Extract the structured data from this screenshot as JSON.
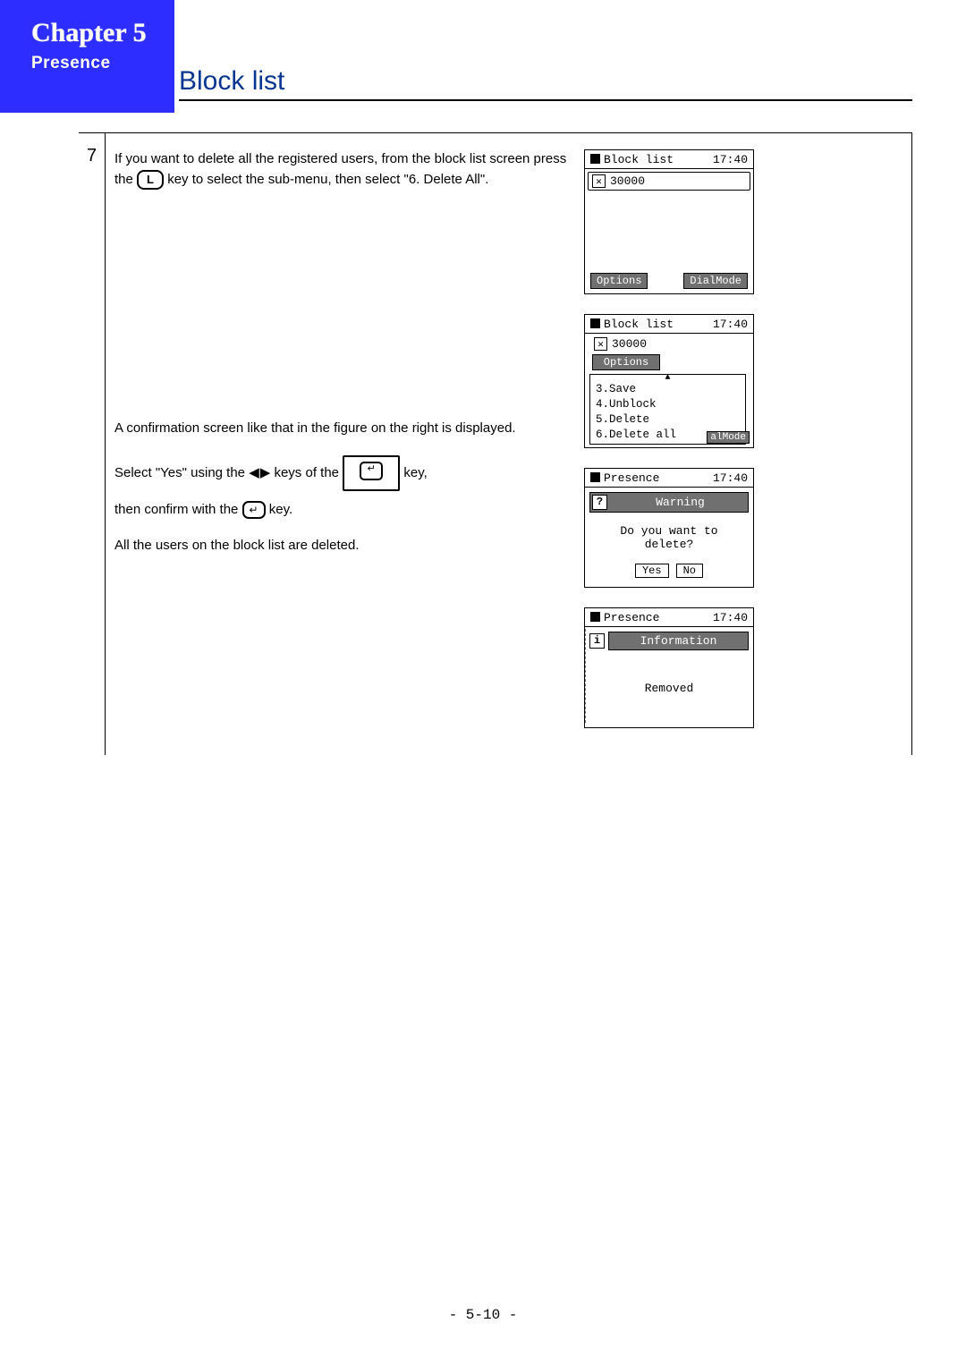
{
  "header": {
    "chapter_label": "Chapter",
    "chapter_number": "5",
    "subtitle": "Presence"
  },
  "page_title": "Block list",
  "step": {
    "number": "7",
    "para1_pre": "If you want to delete all the registered users, from the block list screen press the ",
    "key_L": "L",
    "para1_post": " key to select the sub-menu, then select \"6. Delete All\".",
    "para2": "A confirmation screen like that in the figure on the right is displayed.",
    "para3_pre": "Select \"Yes\" using the ",
    "para3_mid": " keys of the ",
    "para3_post": " key,",
    "para4_pre": "then confirm with the ",
    "para4_post": " key.",
    "para5": "All the users on the block list are deleted."
  },
  "screens": {
    "s1": {
      "title": "Block list",
      "time": "17:40",
      "entry": "30000",
      "soft_left": "Options",
      "soft_right": "DialMode"
    },
    "s2": {
      "title": "Block list",
      "time": "17:40",
      "entry": "30000",
      "soft_top": "Options",
      "menu": {
        "i3": "3.Save",
        "i4": "4.Unblock",
        "i5": "5.Delete",
        "i6": "6.Delete all"
      },
      "tag": "alMode"
    },
    "s3": {
      "title": "Presence",
      "time": "17:40",
      "warning": "Warning",
      "prompt_l1": "Do you want to",
      "prompt_l2": "delete?",
      "yes": "Yes",
      "no": "No"
    },
    "s4": {
      "title": "Presence",
      "time": "17:40",
      "info": "Information",
      "msg": "Removed"
    }
  },
  "page_number": "- 5-10 -"
}
